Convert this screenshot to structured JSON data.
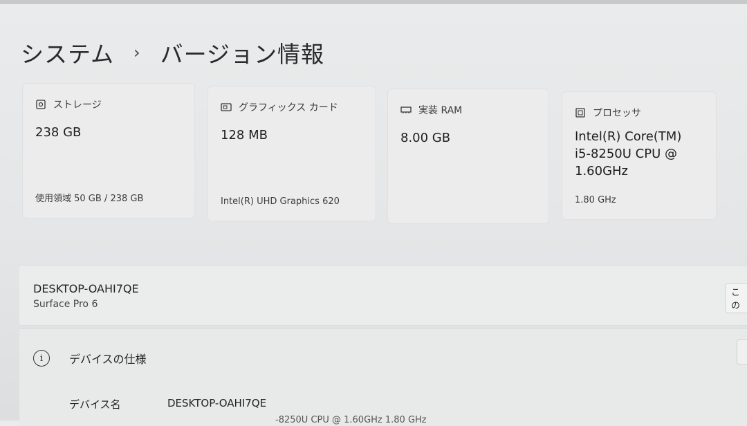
{
  "breadcrumb": {
    "parent": "システム",
    "separator": "›",
    "current": "バージョン情報"
  },
  "cards": [
    {
      "label": "ストレージ",
      "value": "238 GB",
      "sub": "使用領域 50 GB / 238 GB",
      "icon": "storage-icon"
    },
    {
      "label": "グラフィックス カード",
      "value": "128 MB",
      "sub": "Intel(R) UHD Graphics 620",
      "icon": "gpu-icon"
    },
    {
      "label": "実装 RAM",
      "value": "8.00 GB",
      "sub": "",
      "icon": "ram-icon"
    },
    {
      "label": "プロセッサ",
      "value_lines": [
        "Intel(R) Core(TM)",
        "i5-8250U CPU @",
        "1.60GHz"
      ],
      "sub": "1.80 GHz",
      "icon": "cpu-icon"
    }
  ],
  "device": {
    "name": "DESKTOP-OAHI7QE",
    "model": "Surface Pro 6",
    "rename_label": "この"
  },
  "specs": {
    "title": "デバイスの仕様",
    "rows": [
      {
        "key": "デバイス名",
        "value": "DESKTOP-OAHI7QE"
      }
    ],
    "partial_row": "-8250U CPU @ 1.60GHz   1.80 GHz"
  }
}
